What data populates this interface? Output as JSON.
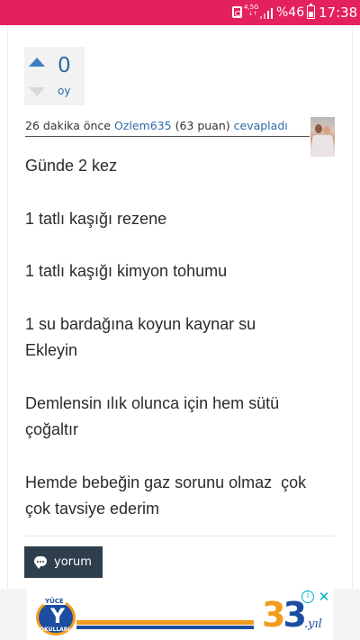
{
  "status_bar": {
    "network_type": "4,5G",
    "network_sub": "↓↑",
    "battery_percent": "%46",
    "time": "17:38"
  },
  "vote": {
    "count": "0",
    "label": "oy"
  },
  "meta": {
    "time_ago": "26 dakika önce",
    "user": "Ozlem635",
    "points": "(63 puan)",
    "action": "cevapladı"
  },
  "answer": {
    "paragraphs": [
      "Günde 2 kez",
      "1 tatlı kaşığı rezene",
      "1 tatlı kaşığı kimyon tohumu",
      "1 su bardağına koyun kaynar su\nEkleyin",
      "Demlensin ılık olunca için hem sütü\nçoğaltır",
      "Hemde bebeğin gaz sorunu olmaz  çok\nçok tavsiye ederim"
    ]
  },
  "comment_button": {
    "label": "yorum"
  },
  "ad": {
    "logo_text": "YÜCE",
    "logo_letter": "Y",
    "logo_sub": "OKULLARI",
    "badge_number_1": "3",
    "badge_number_2": "3",
    "badge_suffix": ".yıl",
    "info_icon": "i",
    "close_icon": "✕"
  },
  "colors": {
    "status_bar": "#e4215f",
    "link": "#2d6aa6",
    "button_bg": "#2e3e4d",
    "ad_blue": "#1b4ea1",
    "ad_orange": "#f29b1d"
  }
}
